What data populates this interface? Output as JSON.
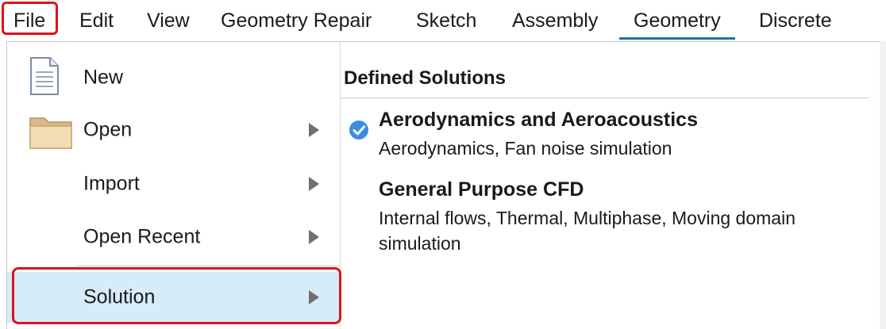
{
  "menubar": {
    "items": [
      {
        "label": "File"
      },
      {
        "label": "Edit"
      },
      {
        "label": "View"
      },
      {
        "label": "Geometry Repair"
      },
      {
        "label": "Sketch"
      },
      {
        "label": "Assembly"
      },
      {
        "label": "Geometry"
      },
      {
        "label": "Discrete"
      }
    ]
  },
  "file_menu": {
    "items": [
      {
        "label": "New",
        "icon": "document-icon",
        "has_submenu": false
      },
      {
        "label": "Open",
        "icon": "folder-icon",
        "has_submenu": true
      },
      {
        "label": "Import",
        "has_submenu": true
      },
      {
        "label": "Open Recent",
        "has_submenu": true
      },
      {
        "label": "Solution",
        "has_submenu": true,
        "selected": true
      }
    ]
  },
  "solutions_panel": {
    "title": "Defined Solutions",
    "entries": [
      {
        "title": "Aerodynamics and Aeroacoustics",
        "description": "Aerodynamics, Fan noise simulation",
        "checked": true
      },
      {
        "title": "General Purpose CFD",
        "description": "Internal flows, Thermal, Multiphase, Moving domain simulation",
        "checked": false
      }
    ]
  },
  "colors": {
    "highlight_border": "#e0121a",
    "selected_bg": "#d6ecf8",
    "active_tab_underline": "#1a73a8",
    "check_blue": "#3a8de0"
  }
}
